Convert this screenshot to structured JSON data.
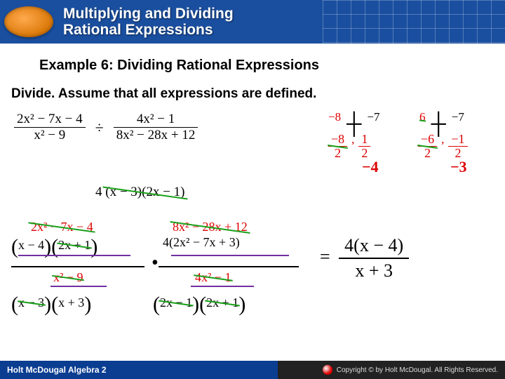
{
  "header": {
    "title_line1": "Multiplying and Dividing",
    "title_line2": "Rational Expressions"
  },
  "example_title": "Example 6: Dividing Rational Expressions",
  "instruction": "Divide. Assume that all expressions are defined.",
  "problem": {
    "left_num": "2x² − 7x − 4",
    "left_den": "x² − 9",
    "op": "÷",
    "right_num": "4x² − 1",
    "right_den": "8x² − 28x + 12"
  },
  "factor_hints": {
    "group1": {
      "tl": "−8",
      "tr": "−7",
      "bl_num": "−8",
      "bl_den": "2",
      "br_num": "1",
      "br_den": "2",
      "result": "−4"
    },
    "group2": {
      "tl": "6",
      "tr": "−7",
      "bl_num": "−6",
      "bl_den": "2",
      "br_num": "−1",
      "br_den": "2",
      "result": "−3"
    }
  },
  "factored": {
    "outer_coef": "4",
    "num_mid": "(x − 3)(2x − 1)",
    "left_top": "(x − 4)(2x + 1)",
    "left_mid": "2x² − 7x − 4",
    "left_bot": "(x − 3)(x + 3)",
    "left_den": "x² − 9",
    "right_top": "4(2x² − 7x + 3)",
    "right_mid": "8x² − 28x + 12",
    "right_bot": "(2x − 1)(2x + 1)",
    "right_den": "4x² − 1",
    "mult": "•"
  },
  "final": {
    "eq": "=",
    "num": "4(x − 4)",
    "den": "x + 3"
  },
  "footer": {
    "book": "Holt McDougal Algebra 2",
    "copyright": "Copyright © by Holt McDougal. All Rights Reserved."
  }
}
